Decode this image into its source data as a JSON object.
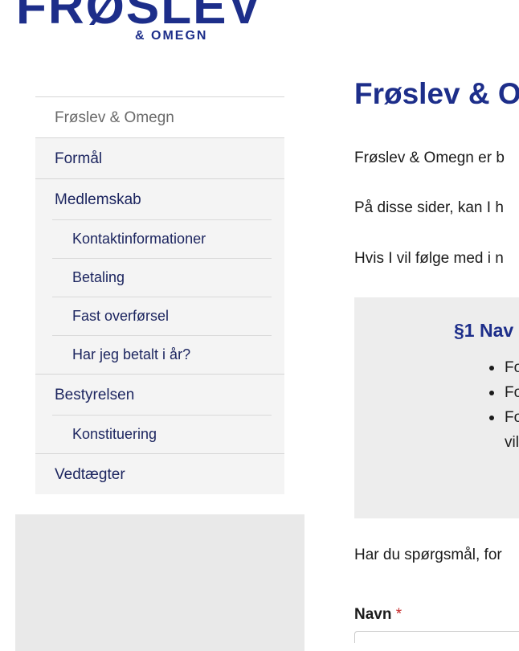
{
  "logo": {
    "main": "FRØSLEV",
    "sub": "& OMEGN"
  },
  "sidebar": {
    "items": [
      {
        "label": "Frøslev & Omegn",
        "active": true
      },
      {
        "label": "Formål"
      },
      {
        "label": "Medlemskab"
      },
      {
        "label": "Kontaktinformationer"
      },
      {
        "label": "Betaling"
      },
      {
        "label": "Fast overførsel"
      },
      {
        "label": "Har jeg betalt i år?"
      },
      {
        "label": "Bestyrelsen"
      },
      {
        "label": "Konstituering"
      },
      {
        "label": "Vedtægter"
      }
    ]
  },
  "main": {
    "title": "Frøslev & O",
    "paragraphs": [
      "Frøslev & Omegn er b",
      "På disse sider, kan I h",
      "Hvis I vil følge med i n"
    ],
    "section": {
      "title": "§1 Nav",
      "items": [
        "Fo",
        "Fo",
        "Fo",
        "vil"
      ]
    },
    "question": "Har du spørgsmål, for",
    "form": {
      "name_label": "Navn",
      "required_mark": "*",
      "name_value": ""
    }
  },
  "colors": {
    "brand": "#1d2e8a",
    "nav_text": "#1d2660",
    "nav_bg": "#f4f4f4",
    "required": "#c62828"
  }
}
